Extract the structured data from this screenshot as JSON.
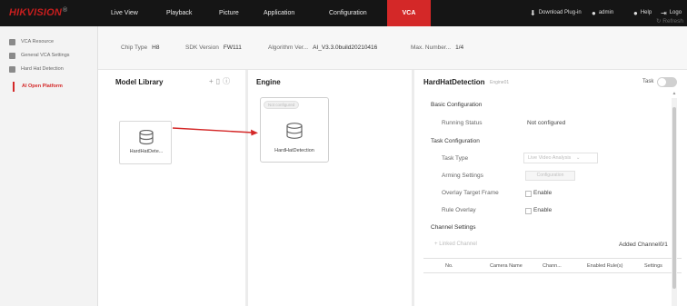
{
  "brand": {
    "name": "HIKVISION",
    "mark": "®"
  },
  "nav": {
    "items": [
      "Live View",
      "Playback",
      "Picture",
      "Application",
      "Configuration",
      "VCA"
    ],
    "active": "VCA"
  },
  "top_right": {
    "download": "Download Plug-in",
    "user": "admin",
    "help": "Help",
    "logout": "Logo"
  },
  "sidebar": {
    "items": [
      "VCA Resource",
      "General VCA Settings",
      "Hard Hat Detection"
    ],
    "sub_active": "AI Open Platform"
  },
  "info": {
    "chip_type_label": "Chip Type",
    "chip_type": "H8",
    "sdk_label": "SDK Version",
    "sdk": "FW111",
    "algorithm_label": "Algorithm Ver...",
    "algorithm": "AI_V3.3.0build20210416",
    "max_number_label": "Max. Number...",
    "max_number": "1/4",
    "refresh": "Refresh"
  },
  "model_library": {
    "title": "Model Library",
    "card_label": "HardHatDete..."
  },
  "engine": {
    "title": "Engine",
    "badge": "Not configured",
    "card_label": "HardHatDetection"
  },
  "detail": {
    "title": "HardHatDetection",
    "engine_id": "Engine01",
    "task_label": "Task",
    "basic_config": "Basic Configuration",
    "running_status_label": "Running Status",
    "running_status": "Not configured",
    "task_config": "Task Configuration",
    "task_type_label": "Task Type",
    "task_type_value": "Live Video Analysis",
    "arming_label": "Arming Settings",
    "arming_button": "Configuration",
    "overlay_target_label": "Overlay Target Frame",
    "overlay_target_check": "Enable",
    "rule_overlay_label": "Rule Overlay",
    "rule_overlay_check": "Enable",
    "channel_settings": "Channel Settings",
    "linked_channel": "Linked Channel",
    "added_channel": "Added Channel0/1",
    "table_headers": [
      "No.",
      "Camera Name",
      "Chann...",
      "Enabled Rule(s)",
      "Settings"
    ]
  },
  "colors": {
    "topbar": "#151515",
    "accent": "#d42828",
    "arrow": "#d42828"
  }
}
